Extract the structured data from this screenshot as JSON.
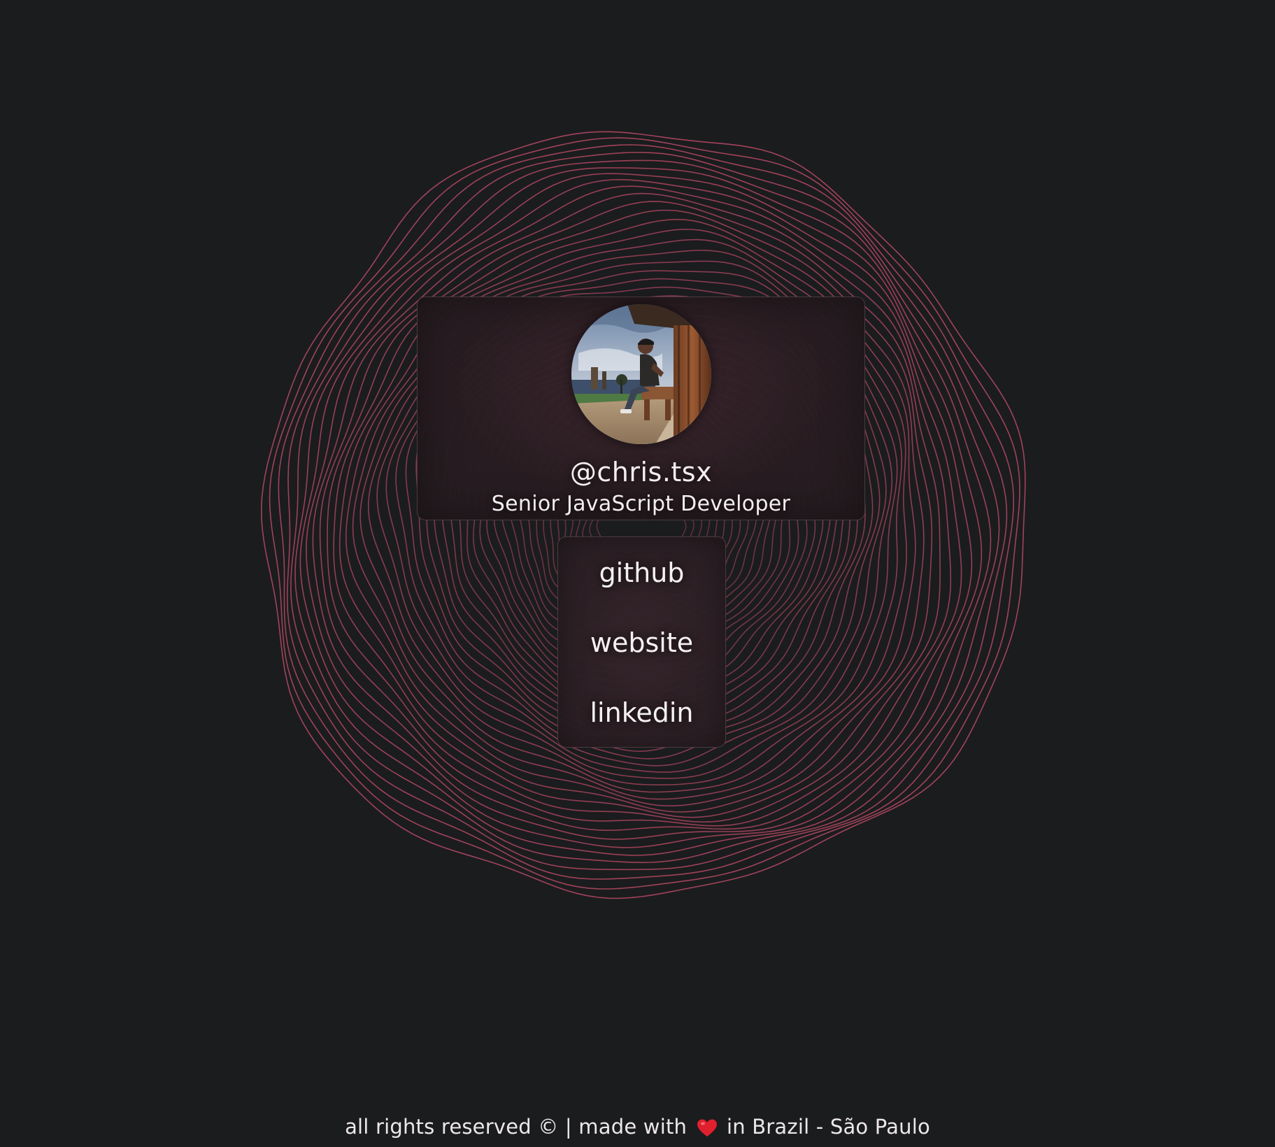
{
  "profile": {
    "username": "@chris.tsx",
    "title": "Senior JavaScript Developer",
    "avatar_icon": "profile-photo"
  },
  "links": [
    {
      "label": "github"
    },
    {
      "label": "website"
    },
    {
      "label": "linkedin"
    }
  ],
  "footer": {
    "before_heart": "all rights reserved © | made with",
    "heart_icon": "heart-icon",
    "after_heart": "in Brazil - São Paulo"
  },
  "colors": {
    "background": "#1b1c1e",
    "ring_stroke": "#b04862",
    "card_border": "#4a3a40",
    "text": "#f3eef0",
    "heart": "#e0202e"
  }
}
